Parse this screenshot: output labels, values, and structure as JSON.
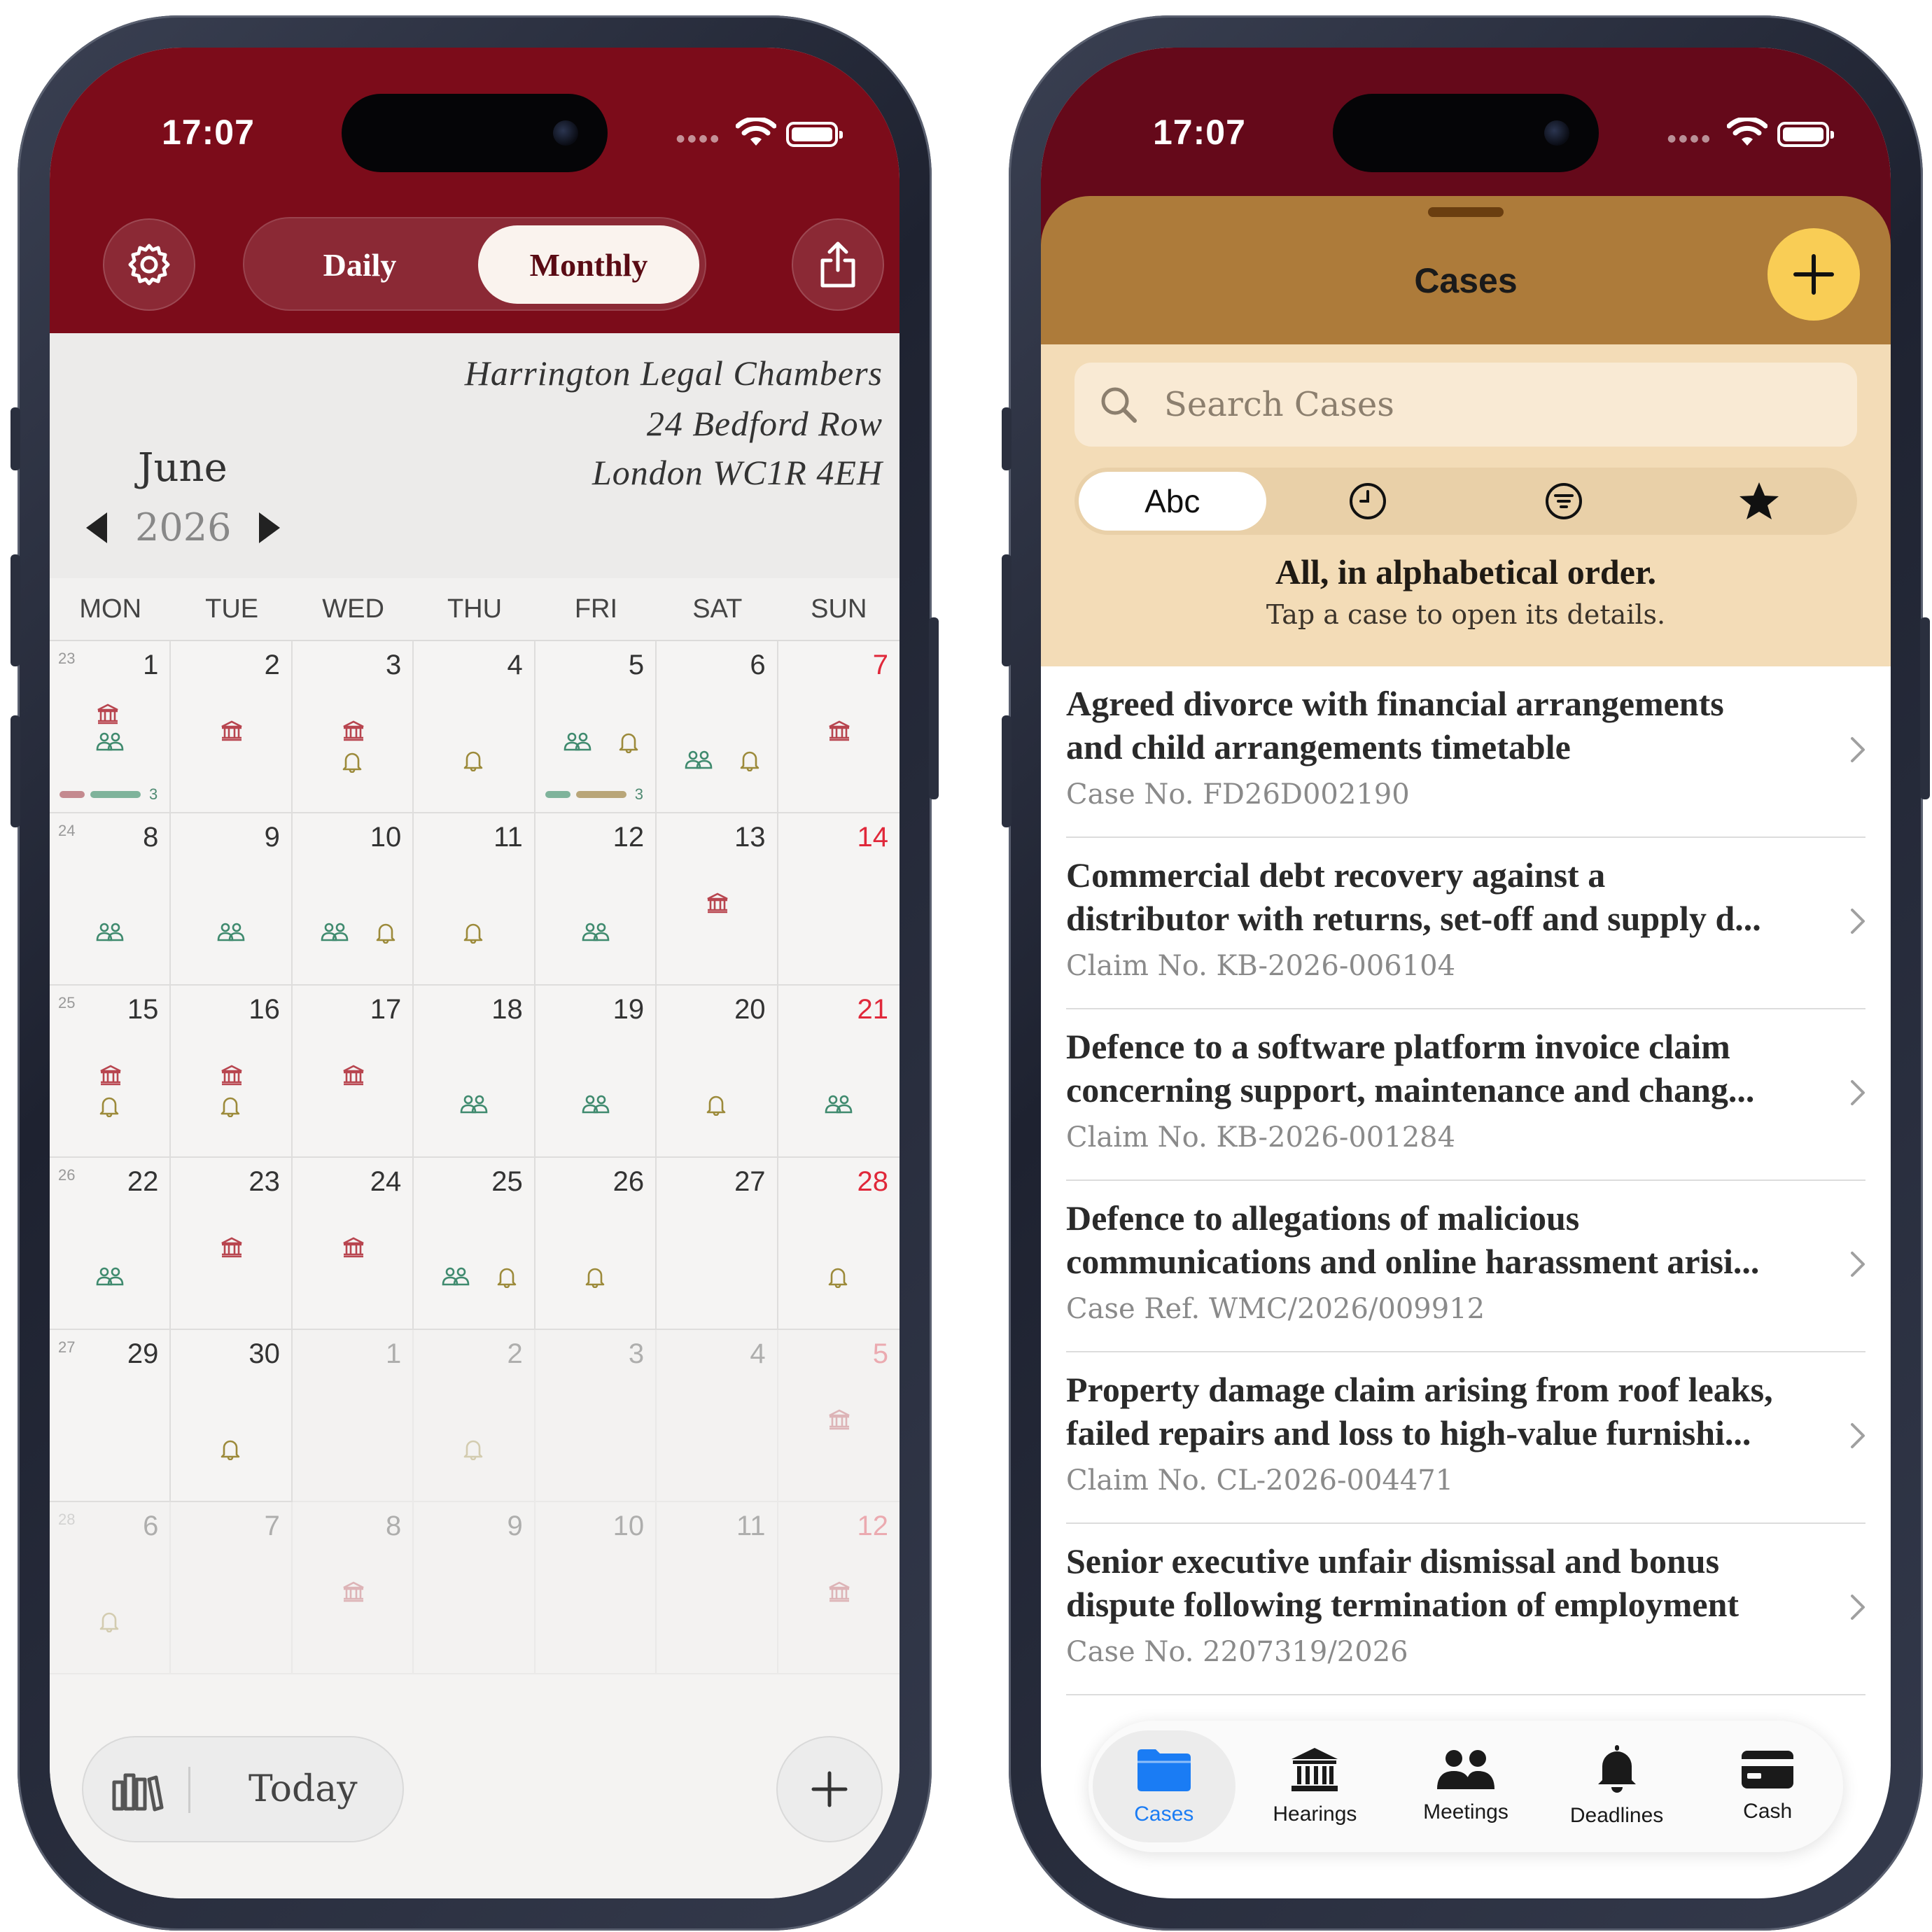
{
  "left_phone": {
    "status": {
      "time": "17:07"
    },
    "header": {
      "segments": [
        "Daily",
        "Monthly"
      ],
      "selected_segment": "Monthly"
    },
    "letterhead": {
      "line1": "Harrington Legal Chambers",
      "line2": "24 Bedford Row",
      "line3": "London WC1R 4EH"
    },
    "month": "June",
    "year": "2026",
    "weekdays": [
      "MON",
      "TUE",
      "WED",
      "THU",
      "FRI",
      "SAT",
      "SUN"
    ],
    "weeks": [
      {
        "week_no": "23",
        "days": [
          {
            "d": "1",
            "icons": [
              "court",
              "meeting"
            ],
            "bars": [
              "#c48a8f",
              "#7fb39b"
            ],
            "count": "3"
          },
          {
            "d": "2",
            "icons": [
              "court"
            ]
          },
          {
            "d": "3",
            "icons": [
              "court",
              "bell"
            ]
          },
          {
            "d": "4",
            "icons": [
              "bell"
            ]
          },
          {
            "d": "5",
            "icons": [
              "meeting",
              "bell"
            ],
            "bars": [
              "#7fb39b",
              "#b9a678"
            ],
            "count": "3"
          },
          {
            "d": "6",
            "icons": [
              "meeting",
              "bell"
            ]
          },
          {
            "d": "7",
            "icons": [
              "court"
            ]
          }
        ]
      },
      {
        "week_no": "24",
        "days": [
          {
            "d": "8",
            "icons": [
              "meeting"
            ]
          },
          {
            "d": "9",
            "icons": [
              "meeting"
            ]
          },
          {
            "d": "10",
            "icons": [
              "meeting",
              "bell"
            ]
          },
          {
            "d": "11",
            "icons": [
              "bell"
            ]
          },
          {
            "d": "12",
            "icons": [
              "meeting"
            ]
          },
          {
            "d": "13",
            "icons": [
              "court"
            ]
          },
          {
            "d": "14",
            "icons": []
          }
        ]
      },
      {
        "week_no": "25",
        "days": [
          {
            "d": "15",
            "icons": [
              "court",
              "bell"
            ]
          },
          {
            "d": "16",
            "icons": [
              "court",
              "bell"
            ]
          },
          {
            "d": "17",
            "icons": [
              "court"
            ]
          },
          {
            "d": "18",
            "icons": [
              "meeting"
            ]
          },
          {
            "d": "19",
            "icons": [
              "meeting"
            ]
          },
          {
            "d": "20",
            "icons": [
              "bell"
            ]
          },
          {
            "d": "21",
            "icons": [
              "meeting"
            ]
          }
        ]
      },
      {
        "week_no": "26",
        "days": [
          {
            "d": "22",
            "icons": [
              "meeting"
            ]
          },
          {
            "d": "23",
            "icons": [
              "court"
            ]
          },
          {
            "d": "24",
            "icons": [
              "court"
            ]
          },
          {
            "d": "25",
            "icons": [
              "meeting",
              "bell"
            ]
          },
          {
            "d": "26",
            "icons": [
              "bell"
            ]
          },
          {
            "d": "27",
            "icons": []
          },
          {
            "d": "28",
            "icons": [
              "bell"
            ]
          }
        ]
      },
      {
        "week_no": "27",
        "days": [
          {
            "d": "29",
            "icons": []
          },
          {
            "d": "30",
            "icons": [
              "bell"
            ]
          },
          {
            "d": "1",
            "dim": true,
            "icons": []
          },
          {
            "d": "2",
            "dim": true,
            "icons": [
              "bell"
            ]
          },
          {
            "d": "3",
            "dim": true,
            "icons": []
          },
          {
            "d": "4",
            "dim": true,
            "icons": []
          },
          {
            "d": "5",
            "dim": true,
            "icons": [
              "court"
            ]
          }
        ]
      },
      {
        "week_no": "28",
        "days": [
          {
            "d": "6",
            "dim": true,
            "icons": [
              "bell"
            ]
          },
          {
            "d": "7",
            "dim": true,
            "icons": []
          },
          {
            "d": "8",
            "dim": true,
            "icons": [
              "court"
            ]
          },
          {
            "d": "9",
            "dim": true,
            "icons": []
          },
          {
            "d": "10",
            "dim": true,
            "icons": []
          },
          {
            "d": "11",
            "dim": true,
            "icons": []
          },
          {
            "d": "12",
            "dim": true,
            "icons": [
              "court"
            ]
          }
        ]
      }
    ],
    "bottom": {
      "today_label": "Today"
    },
    "icon_colors": {
      "court": "#b8454f",
      "meeting": "#3f8a6e",
      "bell": "#9c8a3a"
    }
  },
  "right_phone": {
    "status": {
      "time": "17:07"
    },
    "sheet": {
      "title": "Cases"
    },
    "search": {
      "placeholder": "Search Cases"
    },
    "filters": [
      {
        "label": "Abc",
        "icon": "abc-text"
      },
      {
        "label": "",
        "icon": "clock-icon"
      },
      {
        "label": "",
        "icon": "filter-icon"
      },
      {
        "label": "",
        "icon": "star-icon"
      }
    ],
    "order_title": "All, in alphabetical order.",
    "order_subtitle": "Tap a case to open its details.",
    "cases": [
      {
        "line1": "Agreed divorce with financial arrangements",
        "line2": "and child arrangements timetable",
        "ref": "Case No. FD26D002190"
      },
      {
        "line1": "Commercial debt recovery against a",
        "line2": "distributor with returns, set-off and supply d...",
        "ref": "Claim No. KB-2026-006104"
      },
      {
        "line1": "Defence to a software platform invoice claim",
        "line2": "concerning support, maintenance and chang...",
        "ref": "Claim No. KB-2026-001284"
      },
      {
        "line1": "Defence to allegations of malicious",
        "line2": "communications and online harassment arisi...",
        "ref": "Case Ref. WMC/2026/009912"
      },
      {
        "line1": "Property damage claim arising from roof leaks,",
        "line2": "failed repairs and loss to high-value furnishi...",
        "ref": "Claim No. CL-2026-004471"
      },
      {
        "line1": "Senior executive unfair dismissal and bonus",
        "line2": "dispute following termination of employment",
        "ref": "Case No. 2207319/2026"
      }
    ],
    "tabs": [
      {
        "label": "Cases",
        "icon": "folder-icon",
        "active": true
      },
      {
        "label": "Hearings",
        "icon": "courthouse-icon"
      },
      {
        "label": "Meetings",
        "icon": "people-icon"
      },
      {
        "label": "Deadlines",
        "icon": "bell-icon"
      },
      {
        "label": "Cash",
        "icon": "card-icon"
      }
    ],
    "colors": {
      "accent_tab": "#1a7cf4",
      "sheet_head": "#ad7b3a",
      "filter_bg": "#f3dcb7",
      "add_button": "#f9cd55"
    }
  }
}
